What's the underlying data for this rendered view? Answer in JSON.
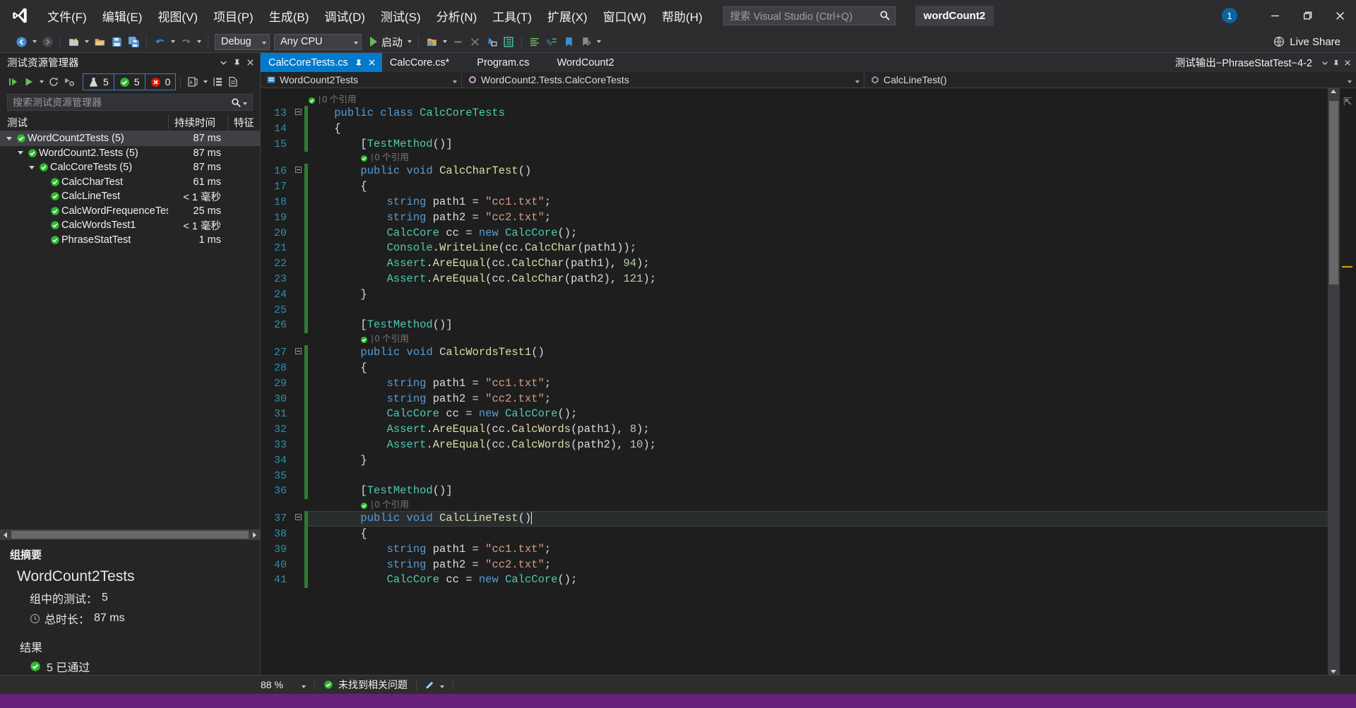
{
  "titlebar": {
    "logo_icon": "visual-studio-logo",
    "menus": [
      {
        "label": "文件(F)"
      },
      {
        "label": "编辑(E)"
      },
      {
        "label": "视图(V)"
      },
      {
        "label": "项目(P)"
      },
      {
        "label": "生成(B)"
      },
      {
        "label": "调试(D)"
      },
      {
        "label": "测试(S)"
      },
      {
        "label": "分析(N)"
      },
      {
        "label": "工具(T)"
      },
      {
        "label": "扩展(X)"
      },
      {
        "label": "窗口(W)"
      },
      {
        "label": "帮助(H)"
      }
    ],
    "search_placeholder": "搜索 Visual Studio (Ctrl+Q)",
    "project_chip": "wordCount2",
    "notification_count": "1",
    "window_buttons": {
      "minimize": "最小化",
      "restore": "还原",
      "close": "关闭"
    }
  },
  "toolbar": {
    "configuration": "Debug",
    "platform": "Any CPU",
    "run_label": "启动",
    "live_share": "Live Share"
  },
  "test_explorer": {
    "title": "测试资源管理器",
    "search_placeholder": "搜索测试资源管理器",
    "counts": {
      "total": "5",
      "passed": "5",
      "failed": "0"
    },
    "columns": {
      "test": "测试",
      "duration": "持续时间",
      "traits": "特征"
    },
    "tree": [
      {
        "label": "WordCount2Tests (5)",
        "duration": "87 ms",
        "traits": "",
        "depth": 0,
        "expandable": true,
        "status": "passed",
        "selected": true
      },
      {
        "label": "WordCount2.Tests (5)",
        "duration": "87 ms",
        "traits": "",
        "depth": 1,
        "expandable": true,
        "status": "passed",
        "selected": false
      },
      {
        "label": "CalcCoreTests (5)",
        "duration": "87 ms",
        "traits": "",
        "depth": 2,
        "expandable": true,
        "status": "passed",
        "selected": false
      },
      {
        "label": "CalcCharTest",
        "duration": "61 ms",
        "traits": "",
        "depth": 3,
        "expandable": false,
        "status": "passed",
        "selected": false
      },
      {
        "label": "CalcLineTest",
        "duration": "< 1 毫秒",
        "traits": "",
        "depth": 3,
        "expandable": false,
        "status": "passed",
        "selected": false
      },
      {
        "label": "CalcWordFrequenceTest",
        "duration": "25 ms",
        "traits": "",
        "depth": 3,
        "expandable": false,
        "status": "passed",
        "selected": false
      },
      {
        "label": "CalcWordsTest1",
        "duration": "< 1 毫秒",
        "traits": "",
        "depth": 3,
        "expandable": false,
        "status": "passed",
        "selected": false
      },
      {
        "label": "PhraseStatTest",
        "duration": "1 ms",
        "traits": "",
        "depth": 3,
        "expandable": false,
        "status": "passed",
        "selected": false
      }
    ],
    "summary": {
      "heading": "组摘要",
      "group_name": "WordCount2Tests",
      "tests_in_group_label": "组中的测试：",
      "tests_in_group_value": "5",
      "duration_label": "总时长：",
      "duration_value": "87 ms",
      "results_heading": "结果",
      "passed_text": "5  已通过"
    }
  },
  "editor": {
    "tabs": [
      {
        "label": "CalcCoreTests.cs",
        "active": true,
        "dirty": false
      },
      {
        "label": "CalcCore.cs*",
        "active": false,
        "dirty": true
      },
      {
        "label": "Program.cs",
        "active": false,
        "dirty": false
      },
      {
        "label": "WordCount2",
        "active": false,
        "dirty": false
      }
    ],
    "output_tab": "测试输出−PhraseStatTest−4-2",
    "breadcrumb": {
      "project": "WordCount2Tests",
      "type": "WordCount2.Tests.CalcCoreTests",
      "member": "CalcLineTest()"
    },
    "code_lines": [
      {
        "num": "",
        "codelens": "0 个引用",
        "tokens": []
      },
      {
        "num": "13",
        "fold": true,
        "tokens": [
          {
            "t": "    ",
            "c": "p"
          },
          {
            "t": "public ",
            "c": "k"
          },
          {
            "t": "class ",
            "c": "k"
          },
          {
            "t": "CalcCoreTests",
            "c": "t"
          }
        ]
      },
      {
        "num": "14",
        "tokens": [
          {
            "t": "    {",
            "c": "p"
          }
        ]
      },
      {
        "num": "15",
        "tokens": [
          {
            "t": "        [",
            "c": "p"
          },
          {
            "t": "TestMethod",
            "c": "t"
          },
          {
            "t": "()]",
            "c": "p"
          }
        ]
      },
      {
        "num": "",
        "codelens": "0 个引用",
        "indent": 8,
        "tokens": []
      },
      {
        "num": "16",
        "fold": true,
        "tokens": [
          {
            "t": "        ",
            "c": "p"
          },
          {
            "t": "public ",
            "c": "k"
          },
          {
            "t": "void ",
            "c": "k"
          },
          {
            "t": "CalcCharTest",
            "c": "m"
          },
          {
            "t": "()",
            "c": "p"
          }
        ]
      },
      {
        "num": "17",
        "tokens": [
          {
            "t": "        {",
            "c": "p"
          }
        ]
      },
      {
        "num": "18",
        "tokens": [
          {
            "t": "            ",
            "c": "p"
          },
          {
            "t": "string ",
            "c": "k"
          },
          {
            "t": "path1 = ",
            "c": "p"
          },
          {
            "t": "\"cc1.txt\"",
            "c": "s"
          },
          {
            "t": ";",
            "c": "p"
          }
        ]
      },
      {
        "num": "19",
        "tokens": [
          {
            "t": "            ",
            "c": "p"
          },
          {
            "t": "string ",
            "c": "k"
          },
          {
            "t": "path2 = ",
            "c": "p"
          },
          {
            "t": "\"cc2.txt\"",
            "c": "s"
          },
          {
            "t": ";",
            "c": "p"
          }
        ]
      },
      {
        "num": "20",
        "tokens": [
          {
            "t": "            ",
            "c": "p"
          },
          {
            "t": "CalcCore",
            "c": "t"
          },
          {
            "t": " cc = ",
            "c": "p"
          },
          {
            "t": "new ",
            "c": "k"
          },
          {
            "t": "CalcCore",
            "c": "t"
          },
          {
            "t": "();",
            "c": "p"
          }
        ]
      },
      {
        "num": "21",
        "tokens": [
          {
            "t": "            ",
            "c": "p"
          },
          {
            "t": "Console",
            "c": "t"
          },
          {
            "t": ".",
            "c": "p"
          },
          {
            "t": "WriteLine",
            "c": "m"
          },
          {
            "t": "(cc.",
            "c": "p"
          },
          {
            "t": "CalcChar",
            "c": "m"
          },
          {
            "t": "(path1));",
            "c": "p"
          }
        ]
      },
      {
        "num": "22",
        "tokens": [
          {
            "t": "            ",
            "c": "p"
          },
          {
            "t": "Assert",
            "c": "t"
          },
          {
            "t": ".",
            "c": "p"
          },
          {
            "t": "AreEqual",
            "c": "m"
          },
          {
            "t": "(cc.",
            "c": "p"
          },
          {
            "t": "CalcChar",
            "c": "m"
          },
          {
            "t": "(path1), ",
            "c": "p"
          },
          {
            "t": "94",
            "c": "n"
          },
          {
            "t": ");",
            "c": "p"
          }
        ]
      },
      {
        "num": "23",
        "tokens": [
          {
            "t": "            ",
            "c": "p"
          },
          {
            "t": "Assert",
            "c": "t"
          },
          {
            "t": ".",
            "c": "p"
          },
          {
            "t": "AreEqual",
            "c": "m"
          },
          {
            "t": "(cc.",
            "c": "p"
          },
          {
            "t": "CalcChar",
            "c": "m"
          },
          {
            "t": "(path2), ",
            "c": "p"
          },
          {
            "t": "121",
            "c": "n"
          },
          {
            "t": ");",
            "c": "p"
          }
        ]
      },
      {
        "num": "24",
        "tokens": [
          {
            "t": "        }",
            "c": "p"
          }
        ]
      },
      {
        "num": "25",
        "tokens": []
      },
      {
        "num": "26",
        "tokens": [
          {
            "t": "        [",
            "c": "p"
          },
          {
            "t": "TestMethod",
            "c": "t"
          },
          {
            "t": "()]",
            "c": "p"
          }
        ]
      },
      {
        "num": "",
        "codelens": "0 个引用",
        "indent": 8,
        "tokens": []
      },
      {
        "num": "27",
        "fold": true,
        "tokens": [
          {
            "t": "        ",
            "c": "p"
          },
          {
            "t": "public ",
            "c": "k"
          },
          {
            "t": "void ",
            "c": "k"
          },
          {
            "t": "CalcWordsTest1",
            "c": "m"
          },
          {
            "t": "()",
            "c": "p"
          }
        ]
      },
      {
        "num": "28",
        "tokens": [
          {
            "t": "        {",
            "c": "p"
          }
        ]
      },
      {
        "num": "29",
        "tokens": [
          {
            "t": "            ",
            "c": "p"
          },
          {
            "t": "string ",
            "c": "k"
          },
          {
            "t": "path1 = ",
            "c": "p"
          },
          {
            "t": "\"cc1.txt\"",
            "c": "s"
          },
          {
            "t": ";",
            "c": "p"
          }
        ]
      },
      {
        "num": "30",
        "tokens": [
          {
            "t": "            ",
            "c": "p"
          },
          {
            "t": "string ",
            "c": "k"
          },
          {
            "t": "path2 = ",
            "c": "p"
          },
          {
            "t": "\"cc2.txt\"",
            "c": "s"
          },
          {
            "t": ";",
            "c": "p"
          }
        ]
      },
      {
        "num": "31",
        "tokens": [
          {
            "t": "            ",
            "c": "p"
          },
          {
            "t": "CalcCore",
            "c": "t"
          },
          {
            "t": " cc = ",
            "c": "p"
          },
          {
            "t": "new ",
            "c": "k"
          },
          {
            "t": "CalcCore",
            "c": "t"
          },
          {
            "t": "();",
            "c": "p"
          }
        ]
      },
      {
        "num": "32",
        "tokens": [
          {
            "t": "            ",
            "c": "p"
          },
          {
            "t": "Assert",
            "c": "t"
          },
          {
            "t": ".",
            "c": "p"
          },
          {
            "t": "AreEqual",
            "c": "m"
          },
          {
            "t": "(cc.",
            "c": "p"
          },
          {
            "t": "CalcWords",
            "c": "m"
          },
          {
            "t": "(path1), ",
            "c": "p"
          },
          {
            "t": "8",
            "c": "n"
          },
          {
            "t": ");",
            "c": "p"
          }
        ]
      },
      {
        "num": "33",
        "tokens": [
          {
            "t": "            ",
            "c": "p"
          },
          {
            "t": "Assert",
            "c": "t"
          },
          {
            "t": ".",
            "c": "p"
          },
          {
            "t": "AreEqual",
            "c": "m"
          },
          {
            "t": "(cc.",
            "c": "p"
          },
          {
            "t": "CalcWords",
            "c": "m"
          },
          {
            "t": "(path2), ",
            "c": "p"
          },
          {
            "t": "10",
            "c": "n"
          },
          {
            "t": ");",
            "c": "p"
          }
        ]
      },
      {
        "num": "34",
        "tokens": [
          {
            "t": "        }",
            "c": "p"
          }
        ]
      },
      {
        "num": "35",
        "tokens": []
      },
      {
        "num": "36",
        "tokens": [
          {
            "t": "        [",
            "c": "p"
          },
          {
            "t": "TestMethod",
            "c": "t"
          },
          {
            "t": "()]",
            "c": "p"
          }
        ]
      },
      {
        "num": "",
        "codelens": "0 个引用",
        "indent": 8,
        "tokens": []
      },
      {
        "num": "37",
        "fold": true,
        "current": true,
        "tokens": [
          {
            "t": "        ",
            "c": "p"
          },
          {
            "t": "public ",
            "c": "k"
          },
          {
            "t": "void ",
            "c": "k"
          },
          {
            "t": "CalcLineTest",
            "c": "m"
          },
          {
            "t": "()",
            "c": "p"
          }
        ]
      },
      {
        "num": "38",
        "tokens": [
          {
            "t": "        {",
            "c": "p"
          }
        ]
      },
      {
        "num": "39",
        "tokens": [
          {
            "t": "            ",
            "c": "p"
          },
          {
            "t": "string ",
            "c": "k"
          },
          {
            "t": "path1 = ",
            "c": "p"
          },
          {
            "t": "\"cc1.txt\"",
            "c": "s"
          },
          {
            "t": ";",
            "c": "p"
          }
        ]
      },
      {
        "num": "40",
        "tokens": [
          {
            "t": "            ",
            "c": "p"
          },
          {
            "t": "string ",
            "c": "k"
          },
          {
            "t": "path2 = ",
            "c": "p"
          },
          {
            "t": "\"cc2.txt\"",
            "c": "s"
          },
          {
            "t": ";",
            "c": "p"
          }
        ]
      },
      {
        "num": "41",
        "tokens": [
          {
            "t": "            ",
            "c": "p"
          },
          {
            "t": "CalcCore",
            "c": "t"
          },
          {
            "t": " cc = ",
            "c": "p"
          },
          {
            "t": "new ",
            "c": "k"
          },
          {
            "t": "CalcCore",
            "c": "t"
          },
          {
            "t": "();",
            "c": "p"
          }
        ]
      }
    ]
  },
  "statusbar": {
    "zoom": "88 %",
    "problems": "未找到相关问题"
  },
  "colors": {
    "accent": "#007acc",
    "pass_green": "#2eb82e",
    "fail_red": "#e51400",
    "purple_strip": "#68217a",
    "keyword_blue": "#569cd6",
    "type_teal": "#4ec9b0",
    "string_orange": "#d69d85",
    "number_green": "#b5cea8",
    "method_yellow": "#dcdcaa"
  }
}
